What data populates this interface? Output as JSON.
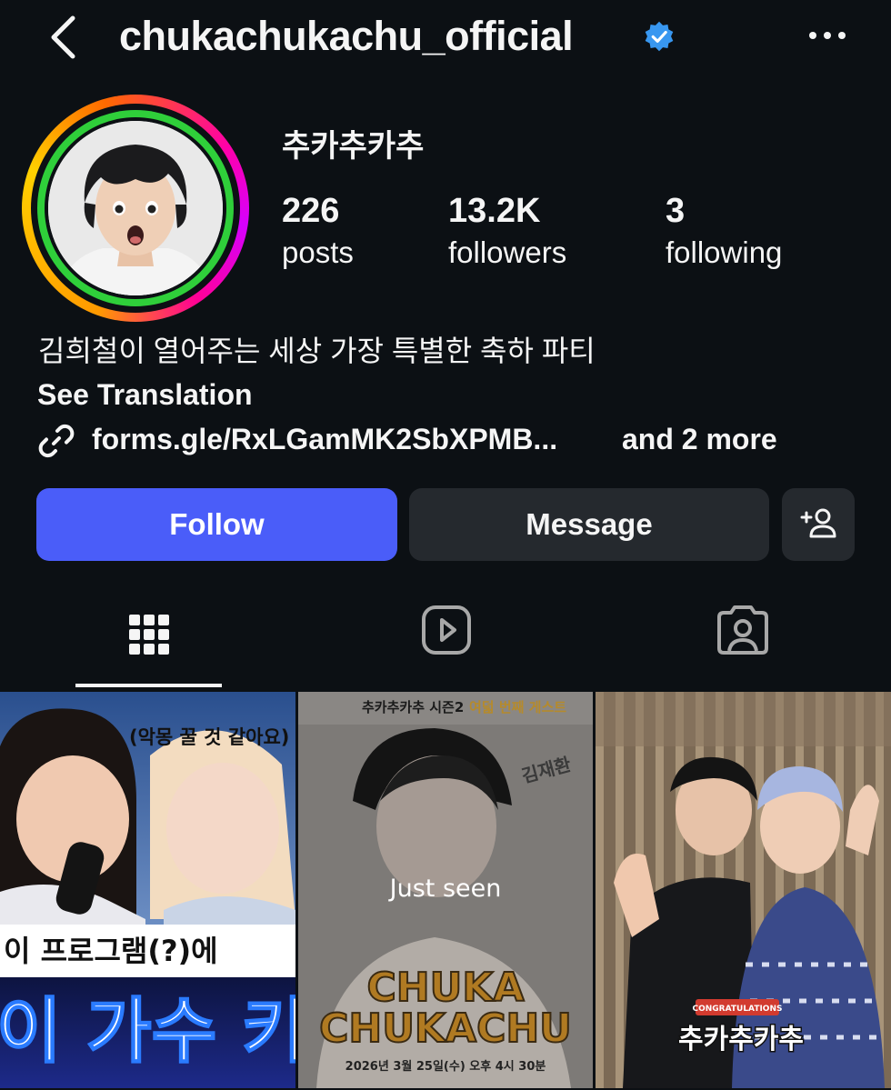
{
  "header": {
    "username": "chukachukachu_official",
    "back_icon": "chevron-left-icon",
    "verified_icon": "verified-badge-icon",
    "more_icon": "ellipsis-icon"
  },
  "profile": {
    "display_name": "추카추카추",
    "stats": {
      "posts": {
        "value": "226",
        "label": "posts"
      },
      "followers": {
        "value": "13.2K",
        "label": "followers"
      },
      "following": {
        "value": "3",
        "label": "following"
      }
    },
    "bio": "김희철이 열어주는 세상 가장 특별한 축하 파티",
    "see_translation": "See Translation",
    "link": {
      "text": "forms.gle/RxLGamMK2SbXPMB...",
      "more": "and 2 more"
    }
  },
  "actions": {
    "follow": "Follow",
    "message": "Message",
    "suggest_icon": "add-person-icon"
  },
  "tabs": [
    {
      "icon": "grid-icon",
      "selected": true
    },
    {
      "icon": "reels-icon",
      "selected": false
    },
    {
      "icon": "tagged-icon",
      "selected": false
    }
  ],
  "posts": [
    {
      "caption_top": "(악몽 꿀 것 같아요)",
      "caption_mid": "이 프로그램(?)에 ",
      "caption_big": "이 가수 키"
    },
    {
      "header": "추카추카추 시즌2",
      "header_accent": "여덟 번째 게스트",
      "overlay": "Just seen",
      "title_line1": "CHUKA",
      "title_line2": "CHUKACHU",
      "date": "2026년 3월 25일(수) 오후 4시 30분",
      "side_text": "김재환"
    },
    {
      "badge_small": "CONGRATULATIONS",
      "badge_main": "추카추카추"
    }
  ],
  "colors": {
    "background": "#0c1014",
    "follow": "#4a5df9",
    "secondary_button": "#25292e",
    "verified": "#3897f0",
    "story_ring_close": "#2fcf3a"
  }
}
